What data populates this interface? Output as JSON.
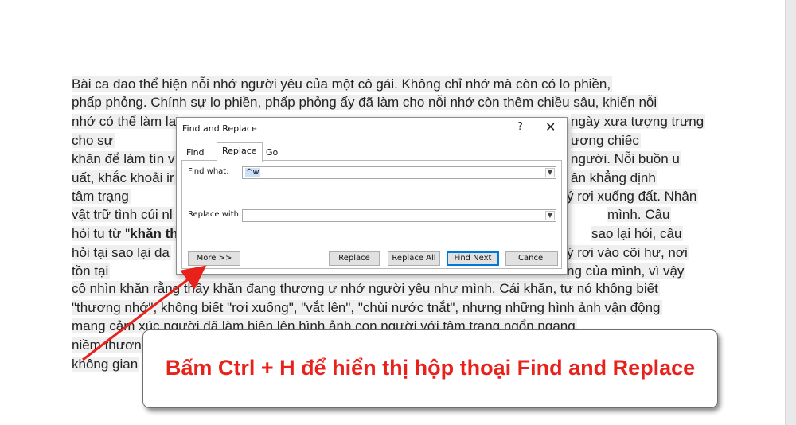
{
  "document": {
    "lines": [
      {
        "t": "Bài ca dao thể hiện nỗi              nhớ người yêu của một cô gái. Không chỉ nhớ mà còn có lo phiền,"
      },
      {
        "t": "phấp phỏng. Chính sự lo phiền, phấp  phỏng ấy đã làm cho nỗi nhớ còn thêm chiều sâu, khiến nỗi"
      },
      {
        "t": "nhớ có thể làm la"
      },
      {
        "t": "cho sự"
      },
      {
        "t": "khăn để làm tín v"
      },
      {
        "t": "uất, khắc khoải ir"
      },
      {
        "t": "tâm trạng"
      },
      {
        "t": "vật trữ tình cúi nl"
      },
      {
        "pre": "hỏi tu từ \"",
        "bold": "khăn th"
      },
      {
        "t": "hỏi tại sao lại da"
      },
      {
        "t": "tồn tại"
      },
      {
        "t": "cô nhìn khăn       rằng thấy khăn đang thương ư nhớ người yêu như mình.  Cái khăn, tự nó không biết"
      },
      {
        "t": "\"thương nhớ\", không biết \"rơi xuống\", \"vắt lên\", \"chùi nước tnắt\", nhưng những hình ảnh vận động"
      },
      {
        "t": "mang cảm xúc người đã làm hiện lên hình ảnh con người với           tâm trạng ngổn ngang"
      },
      {
        "t": "niềm thương"
      },
      {
        "t": "không gian"
      }
    ],
    "right_fragments": [
      {
        "t": "ngày xưa tượng trưng"
      },
      {
        "t": "ương          chiếc"
      },
      {
        "t": "người. Nỗi buồn u"
      },
      {
        "t": "ân khẳng định"
      },
      {
        "t": "ý rơi xuống  đất. Nhân"
      },
      {
        "t": "mình. Câu"
      },
      {
        "t": "sao lại hỏi, câu"
      },
      {
        "t": "ý rơi vào cõi hư, nơi"
      },
      {
        "t": "ng của mình, vì vậy"
      }
    ]
  },
  "dialog": {
    "title": "Find and Replace",
    "help": "?",
    "close": "✕",
    "tabs": [
      "Find",
      "Replace",
      "Go To"
    ],
    "find_label": "Find what:",
    "find_value": "^w",
    "replace_label": "Replace with:",
    "replace_value": "",
    "buttons": {
      "more": "More >>",
      "replace": "Replace",
      "replace_all": "Replace All",
      "find_next": "Find Next",
      "cancel": "Cancel"
    }
  },
  "callout": {
    "text": "Bấm Ctrl + H để hiển thị hộp thoại Find and Replace"
  },
  "colors": {
    "accent_red": "#e8221b",
    "default_button_border": "#0078d7"
  }
}
